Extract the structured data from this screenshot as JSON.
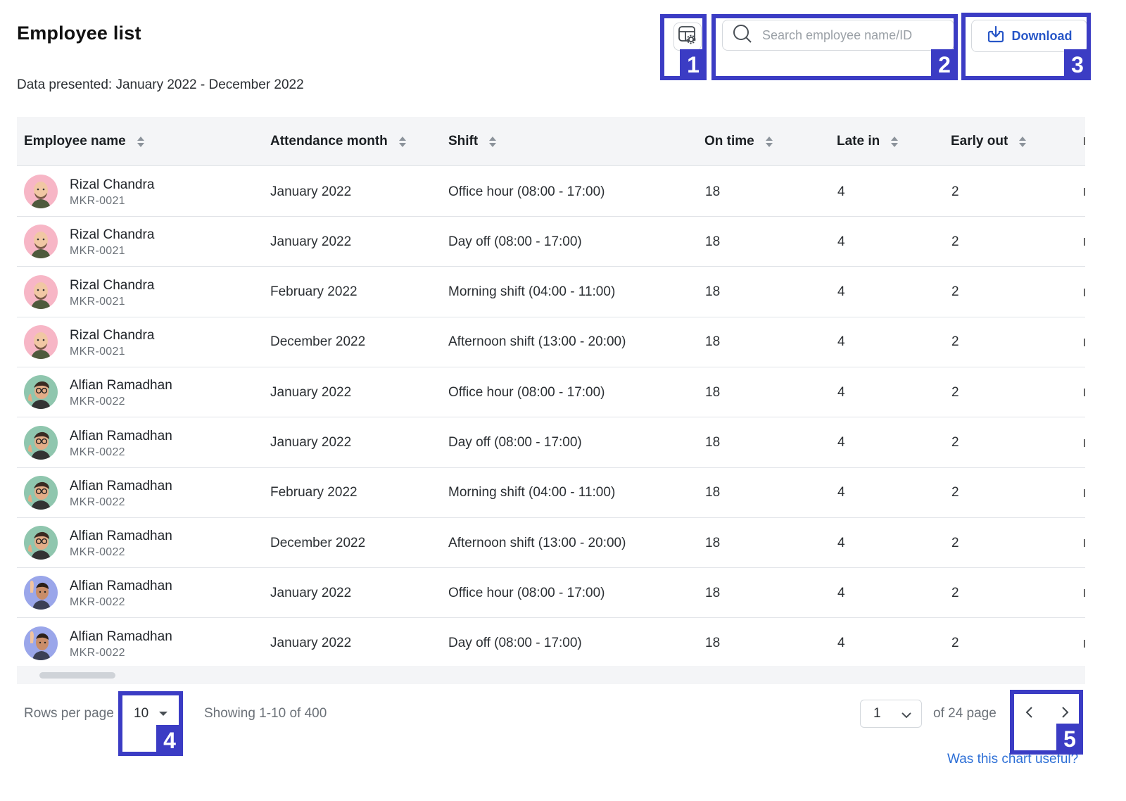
{
  "header": {
    "title": "Employee list",
    "subtitle": "Data presented: January 2022 - December 2022",
    "settings_icon": "table-settings-icon",
    "search_placeholder": "Search employee name/ID",
    "search_value": "",
    "download_label": "Download",
    "accent_color": "#2756c7"
  },
  "callouts": [
    "1",
    "2",
    "3",
    "4",
    "5"
  ],
  "callout_color": "#3b3cc4",
  "table": {
    "columns": [
      "Employee name",
      "Attendance month",
      "Shift",
      "On time",
      "Late in",
      "Early out"
    ],
    "rows": [
      {
        "name": "Rizal Chandra",
        "id": "MKR-0021",
        "avatar": "avatar-bald-man",
        "month": "January 2022",
        "shift": "Office hour (08:00 - 17:00)",
        "on_time": "18",
        "late_in": "4",
        "early_out": "2"
      },
      {
        "name": "Rizal Chandra",
        "id": "MKR-0021",
        "avatar": "avatar-bald-man",
        "month": "January 2022",
        "shift": "Day off (08:00 - 17:00)",
        "on_time": "18",
        "late_in": "4",
        "early_out": "2"
      },
      {
        "name": "Rizal Chandra",
        "id": "MKR-0021",
        "avatar": "avatar-bald-man",
        "month": "February 2022",
        "shift": "Morning shift (04:00 - 11:00)",
        "on_time": "18",
        "late_in": "4",
        "early_out": "2"
      },
      {
        "name": "Rizal Chandra",
        "id": "MKR-0021",
        "avatar": "avatar-bald-man",
        "month": "December 2022",
        "shift": "Afternoon shift (13:00 - 20:00)",
        "on_time": "18",
        "late_in": "4",
        "early_out": "2"
      },
      {
        "name": "Alfian Ramadhan",
        "id": "MKR-0022",
        "avatar": "avatar-glasses-man",
        "month": "January 2022",
        "shift": "Office hour (08:00 - 17:00)",
        "on_time": "18",
        "late_in": "4",
        "early_out": "2"
      },
      {
        "name": "Alfian Ramadhan",
        "id": "MKR-0022",
        "avatar": "avatar-glasses-man",
        "month": "January 2022",
        "shift": "Day off (08:00 - 17:00)",
        "on_time": "18",
        "late_in": "4",
        "early_out": "2"
      },
      {
        "name": "Alfian Ramadhan",
        "id": "MKR-0022",
        "avatar": "avatar-glasses-man",
        "month": "February 2022",
        "shift": "Morning shift (04:00 - 11:00)",
        "on_time": "18",
        "late_in": "4",
        "early_out": "2"
      },
      {
        "name": "Alfian Ramadhan",
        "id": "MKR-0022",
        "avatar": "avatar-glasses-man",
        "month": "December 2022",
        "shift": "Afternoon shift (13:00 - 20:00)",
        "on_time": "18",
        "late_in": "4",
        "early_out": "2"
      },
      {
        "name": "Alfian Ramadhan",
        "id": "MKR-0022",
        "avatar": "avatar-waving-man",
        "month": "January 2022",
        "shift": "Office hour (08:00 - 17:00)",
        "on_time": "18",
        "late_in": "4",
        "early_out": "2"
      },
      {
        "name": "Alfian Ramadhan",
        "id": "MKR-0022",
        "avatar": "avatar-waving-man",
        "month": "January 2022",
        "shift": "Day off (08:00 - 17:00)",
        "on_time": "18",
        "late_in": "4",
        "early_out": "2"
      }
    ]
  },
  "pagination": {
    "rows_per_page_label": "Rows per page",
    "rows_per_page_value": "10",
    "showing": "Showing 1-10 of 400",
    "current_page": "1",
    "of_pages": "of 24 page",
    "prev_icon": "chevron-left-icon",
    "next_icon": "chevron-right-icon"
  },
  "footer": {
    "feedback": "Was this chart useful?",
    "link_color": "#2d6fd6"
  }
}
